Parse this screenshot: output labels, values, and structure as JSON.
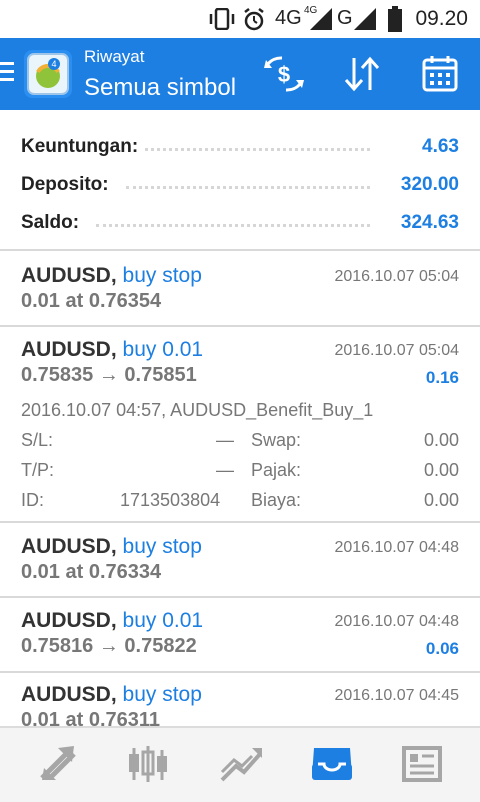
{
  "status_bar": {
    "time": "09.20",
    "network_label": "4G",
    "network_sup": "4G",
    "network2_label": "G",
    "icons": [
      "vibrate-icon",
      "alarm-icon",
      "signal-icon",
      "battery-icon"
    ]
  },
  "app_bar": {
    "subtitle": "Riwayat",
    "title": "Semua simbol",
    "actions": [
      "exchange-dollar-icon",
      "sort-icon",
      "calendar-icon"
    ],
    "accent_color": "#1d7fe1"
  },
  "summary": {
    "rows": [
      {
        "label": "Keuntungan:",
        "value": "4.63"
      },
      {
        "label": "Deposito:",
        "value": "320.00"
      },
      {
        "label": "Saldo:",
        "value": "324.63"
      }
    ]
  },
  "entries": [
    {
      "symbol": "AUDUSD,",
      "type": "buy stop",
      "date": "2016.10.07 05:04",
      "sub": "0.01 at 0.76354"
    },
    {
      "symbol": "AUDUSD,",
      "type": "buy 0.01",
      "date": "2016.10.07 05:04",
      "sub": "0.75835 → 0.75851",
      "profit": "0.16",
      "comment": "2016.10.07 04:57, AUDUSD_Benefit_Buy_1",
      "details": {
        "sl_label": "S/L:",
        "sl_value": "—",
        "tp_label": "T/P:",
        "tp_value": "—",
        "id_label": "ID:",
        "id_value": "1713503804",
        "swap_label": "Swap:",
        "swap_value": "0.00",
        "tax_label": "Pajak:",
        "tax_value": "0.00",
        "fee_label": "Biaya:",
        "fee_value": "0.00"
      }
    },
    {
      "symbol": "AUDUSD,",
      "type": "buy stop",
      "date": "2016.10.07 04:48",
      "sub": "0.01 at 0.76334"
    },
    {
      "symbol": "AUDUSD,",
      "type": "buy 0.01",
      "date": "2016.10.07 04:48",
      "sub": "0.75816 → 0.75822",
      "profit": "0.06"
    },
    {
      "symbol": "AUDUSD,",
      "type": "buy stop",
      "date": "2016.10.07 04:45",
      "sub": "0.01 at 0.76311"
    }
  ],
  "bottom_nav": {
    "items": [
      "quotes-icon",
      "chart-icon",
      "trade-icon",
      "history-icon",
      "news-icon"
    ],
    "active": "history-icon"
  }
}
